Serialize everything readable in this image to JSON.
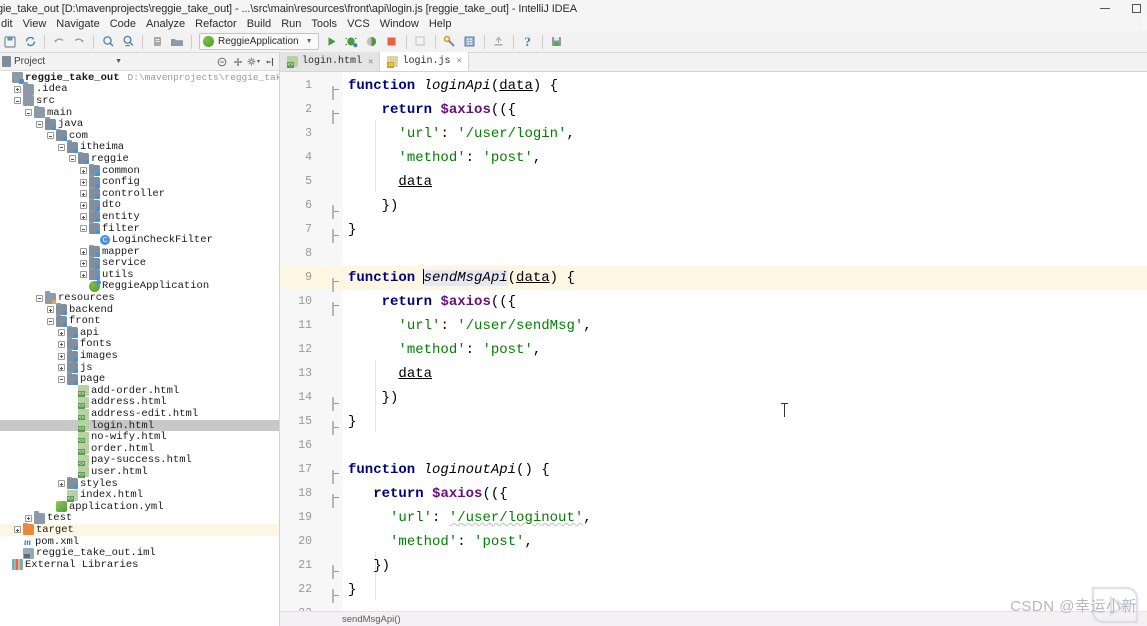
{
  "window": {
    "title": "gie_take_out [D:\\mavenprojects\\reggie_take_out] - ...\\src\\main\\resources\\front\\api\\login.js [reggie_take_out] - IntelliJ IDEA",
    "minimize_label": "minimize",
    "maximize_label": "maximize"
  },
  "menubar": {
    "items": [
      "dit",
      "View",
      "Navigate",
      "Code",
      "Analyze",
      "Refactor",
      "Build",
      "Run",
      "Tools",
      "VCS",
      "Window",
      "Help"
    ]
  },
  "toolbar": {
    "run_config": "ReggieApplication",
    "icons": [
      "save-all-icon",
      "sync-icon",
      "back-arrow-icon",
      "forward-arrow-icon",
      "search-everywhere-icon",
      "find-usages-icon",
      "settings-project-icon",
      "open-folder-icon"
    ],
    "run_icons": [
      "run-icon",
      "debug-icon",
      "run-with-coverage-icon",
      "profile-icon",
      "stop-icon"
    ],
    "right_icons": [
      "structure-icon",
      "build-icon",
      "database-icon",
      "deploy-icon",
      "help-icon",
      "save-icon"
    ]
  },
  "project_panel": {
    "title": "Project",
    "header_icons": [
      "collapse-all-icon",
      "scroll-from-source-icon",
      "gear-icon",
      "hide-icon"
    ],
    "tree": [
      {
        "depth": 0,
        "label": "reggie_take_out",
        "path": "D:\\mavenprojects\\reggie_take_out",
        "icon": "module",
        "toggle": "none",
        "bold": true
      },
      {
        "depth": 1,
        "label": ".idea",
        "icon": "folder",
        "toggle": "plus"
      },
      {
        "depth": 1,
        "label": "src",
        "icon": "folder",
        "toggle": "minus"
      },
      {
        "depth": 2,
        "label": "main",
        "icon": "folder",
        "toggle": "minus"
      },
      {
        "depth": 3,
        "label": "java",
        "icon": "folder-src",
        "toggle": "minus"
      },
      {
        "depth": 4,
        "label": "com",
        "icon": "folder-pkg",
        "toggle": "minus"
      },
      {
        "depth": 5,
        "label": "itheima",
        "icon": "folder-pkg",
        "toggle": "minus"
      },
      {
        "depth": 6,
        "label": "reggie",
        "icon": "folder-pkg",
        "toggle": "minus"
      },
      {
        "depth": 7,
        "label": "common",
        "icon": "folder-pkg",
        "toggle": "plus"
      },
      {
        "depth": 7,
        "label": "config",
        "icon": "folder-pkg",
        "toggle": "plus"
      },
      {
        "depth": 7,
        "label": "controller",
        "icon": "folder-pkg",
        "toggle": "plus"
      },
      {
        "depth": 7,
        "label": "dto",
        "icon": "folder-pkg",
        "toggle": "plus"
      },
      {
        "depth": 7,
        "label": "entity",
        "icon": "folder-pkg",
        "toggle": "plus"
      },
      {
        "depth": 7,
        "label": "filter",
        "icon": "folder-pkg",
        "toggle": "minus"
      },
      {
        "depth": 8,
        "label": "LoginCheckFilter",
        "icon": "class",
        "toggle": "none"
      },
      {
        "depth": 7,
        "label": "mapper",
        "icon": "folder-pkg",
        "toggle": "plus"
      },
      {
        "depth": 7,
        "label": "service",
        "icon": "folder-pkg",
        "toggle": "plus"
      },
      {
        "depth": 7,
        "label": "utils",
        "icon": "folder-pkg",
        "toggle": "plus"
      },
      {
        "depth": 7,
        "label": "ReggieApplication",
        "icon": "spring",
        "toggle": "none"
      },
      {
        "depth": 3,
        "label": "resources",
        "icon": "folder-res",
        "toggle": "minus"
      },
      {
        "depth": 4,
        "label": "backend",
        "icon": "folder-pkg",
        "toggle": "plus"
      },
      {
        "depth": 4,
        "label": "front",
        "icon": "folder-pkg",
        "toggle": "minus"
      },
      {
        "depth": 5,
        "label": "api",
        "icon": "folder-pkg",
        "toggle": "plus"
      },
      {
        "depth": 5,
        "label": "fonts",
        "icon": "folder-pkg",
        "toggle": "plus"
      },
      {
        "depth": 5,
        "label": "images",
        "icon": "folder-pkg",
        "toggle": "plus"
      },
      {
        "depth": 5,
        "label": "js",
        "icon": "folder-pkg",
        "toggle": "plus"
      },
      {
        "depth": 5,
        "label": "page",
        "icon": "folder-pkg",
        "toggle": "minus"
      },
      {
        "depth": 6,
        "label": "add-order.html",
        "icon": "html",
        "toggle": "none"
      },
      {
        "depth": 6,
        "label": "address.html",
        "icon": "html",
        "toggle": "none"
      },
      {
        "depth": 6,
        "label": "address-edit.html",
        "icon": "html",
        "toggle": "none"
      },
      {
        "depth": 6,
        "label": "login.html",
        "icon": "html",
        "toggle": "none",
        "selected": true
      },
      {
        "depth": 6,
        "label": "no-wify.html",
        "icon": "html",
        "toggle": "none"
      },
      {
        "depth": 6,
        "label": "order.html",
        "icon": "html",
        "toggle": "none"
      },
      {
        "depth": 6,
        "label": "pay-success.html",
        "icon": "html",
        "toggle": "none"
      },
      {
        "depth": 6,
        "label": "user.html",
        "icon": "html",
        "toggle": "none"
      },
      {
        "depth": 5,
        "label": "styles",
        "icon": "folder-pkg",
        "toggle": "plus"
      },
      {
        "depth": 5,
        "label": "index.html",
        "icon": "html",
        "toggle": "none"
      },
      {
        "depth": 4,
        "label": "application.yml",
        "icon": "yml",
        "toggle": "none"
      },
      {
        "depth": 2,
        "label": "test",
        "icon": "folder",
        "toggle": "plus"
      },
      {
        "depth": 1,
        "label": "target",
        "icon": "folder-target",
        "toggle": "plus",
        "highlight": true
      },
      {
        "depth": 1,
        "label": "pom.xml",
        "icon": "maven",
        "toggle": "none"
      },
      {
        "depth": 1,
        "label": "reggie_take_out.iml",
        "icon": "iml",
        "toggle": "none"
      },
      {
        "depth": 0,
        "label": "External Libraries",
        "icon": "lib",
        "toggle": "none"
      }
    ]
  },
  "editor": {
    "tabs": [
      {
        "label": "login.html",
        "icon": "html-file-icon",
        "active": false
      },
      {
        "label": "login.js",
        "icon": "js-file-icon",
        "active": true
      }
    ],
    "breadcrumb": "sendMsgApi()",
    "lines": [
      {
        "n": 1,
        "fold": "open",
        "tokens": [
          {
            "t": "kw",
            "v": "function"
          },
          {
            "t": "sp",
            "v": " "
          },
          {
            "t": "fn",
            "v": "loginApi"
          },
          {
            "t": "p",
            "v": "("
          },
          {
            "t": "param",
            "v": "data"
          },
          {
            "t": "p",
            "v": ") {"
          }
        ]
      },
      {
        "n": 2,
        "fold": "open",
        "indent": 1,
        "tokens": [
          {
            "t": "sp",
            "v": "    "
          },
          {
            "t": "kw",
            "v": "return"
          },
          {
            "t": "sp",
            "v": " "
          },
          {
            "t": "axios",
            "v": "$axios"
          },
          {
            "t": "p",
            "v": "(({"
          }
        ]
      },
      {
        "n": 3,
        "indent": 2,
        "tokens": [
          {
            "t": "sp",
            "v": "      "
          },
          {
            "t": "str",
            "v": "'url'"
          },
          {
            "t": "p",
            "v": ": "
          },
          {
            "t": "str",
            "v": "'/user/login'"
          },
          {
            "t": "p",
            "v": ","
          }
        ]
      },
      {
        "n": 4,
        "indent": 2,
        "tokens": [
          {
            "t": "sp",
            "v": "      "
          },
          {
            "t": "str",
            "v": "'method'"
          },
          {
            "t": "p",
            "v": ": "
          },
          {
            "t": "str",
            "v": "'post'"
          },
          {
            "t": "p",
            "v": ","
          }
        ]
      },
      {
        "n": 5,
        "indent": 2,
        "tokens": [
          {
            "t": "sp",
            "v": "      "
          },
          {
            "t": "param",
            "v": "data"
          }
        ]
      },
      {
        "n": 6,
        "fold": "close",
        "indent": 1,
        "tokens": [
          {
            "t": "sp",
            "v": "    "
          },
          {
            "t": "p",
            "v": "})"
          }
        ]
      },
      {
        "n": 7,
        "fold": "close",
        "tokens": [
          {
            "t": "p",
            "v": "}"
          }
        ]
      },
      {
        "n": 8,
        "tokens": []
      },
      {
        "n": 9,
        "fold": "open",
        "highlight": true,
        "tokens": [
          {
            "t": "kw",
            "v": "function"
          },
          {
            "t": "sp",
            "v": " "
          },
          {
            "t": "caret",
            "v": ""
          },
          {
            "t": "fnhl",
            "v": "sendMsgApi"
          },
          {
            "t": "p",
            "v": "("
          },
          {
            "t": "param",
            "v": "data"
          },
          {
            "t": "p",
            "v": ") {"
          }
        ]
      },
      {
        "n": 10,
        "fold": "open",
        "indent": 1,
        "tokens": [
          {
            "t": "sp",
            "v": "    "
          },
          {
            "t": "kw",
            "v": "return"
          },
          {
            "t": "sp",
            "v": " "
          },
          {
            "t": "axios",
            "v": "$axios"
          },
          {
            "t": "p",
            "v": "(({"
          }
        ]
      },
      {
        "n": 11,
        "indent": 2,
        "tokens": [
          {
            "t": "sp",
            "v": "      "
          },
          {
            "t": "str",
            "v": "'url'"
          },
          {
            "t": "p",
            "v": ": "
          },
          {
            "t": "str",
            "v": "'/user/sendMsg'"
          },
          {
            "t": "p",
            "v": ","
          }
        ]
      },
      {
        "n": 12,
        "indent": 2,
        "tokens": [
          {
            "t": "sp",
            "v": "      "
          },
          {
            "t": "str",
            "v": "'method'"
          },
          {
            "t": "p",
            "v": ": "
          },
          {
            "t": "str",
            "v": "'post'"
          },
          {
            "t": "p",
            "v": ","
          }
        ]
      },
      {
        "n": 13,
        "indent": 2,
        "tokens": [
          {
            "t": "sp",
            "v": "      "
          },
          {
            "t": "param",
            "v": "data"
          }
        ]
      },
      {
        "n": 14,
        "fold": "close",
        "indent": 1,
        "tokens": [
          {
            "t": "sp",
            "v": "    "
          },
          {
            "t": "p",
            "v": "})"
          }
        ]
      },
      {
        "n": 15,
        "fold": "close",
        "tokens": [
          {
            "t": "p",
            "v": "}"
          }
        ]
      },
      {
        "n": 16,
        "tokens": []
      },
      {
        "n": 17,
        "fold": "open",
        "tokens": [
          {
            "t": "kw",
            "v": "function"
          },
          {
            "t": "sp",
            "v": " "
          },
          {
            "t": "fn",
            "v": "loginoutApi"
          },
          {
            "t": "p",
            "v": "() {"
          }
        ]
      },
      {
        "n": 18,
        "fold": "open",
        "indent": 1,
        "tokens": [
          {
            "t": "sp",
            "v": "   "
          },
          {
            "t": "kw",
            "v": "return"
          },
          {
            "t": "sp",
            "v": " "
          },
          {
            "t": "axios",
            "v": "$axios"
          },
          {
            "t": "p",
            "v": "(({"
          }
        ]
      },
      {
        "n": 19,
        "indent": 2,
        "tokens": [
          {
            "t": "sp",
            "v": "     "
          },
          {
            "t": "str",
            "v": "'url'"
          },
          {
            "t": "p",
            "v": ": "
          },
          {
            "t": "strspell",
            "v": "'/user/loginout'"
          },
          {
            "t": "p",
            "v": ","
          }
        ]
      },
      {
        "n": 20,
        "indent": 2,
        "tokens": [
          {
            "t": "sp",
            "v": "     "
          },
          {
            "t": "str",
            "v": "'method'"
          },
          {
            "t": "p",
            "v": ": "
          },
          {
            "t": "str",
            "v": "'post'"
          },
          {
            "t": "p",
            "v": ","
          }
        ]
      },
      {
        "n": 21,
        "fold": "close",
        "indent": 1,
        "tokens": [
          {
            "t": "sp",
            "v": "   "
          },
          {
            "t": "p",
            "v": "})"
          }
        ]
      },
      {
        "n": 22,
        "fold": "close",
        "tokens": [
          {
            "t": "p",
            "v": "}"
          }
        ]
      },
      {
        "n": 23,
        "tokens": []
      }
    ]
  },
  "watermark": {
    "text": "CSDN @幸运小新"
  }
}
